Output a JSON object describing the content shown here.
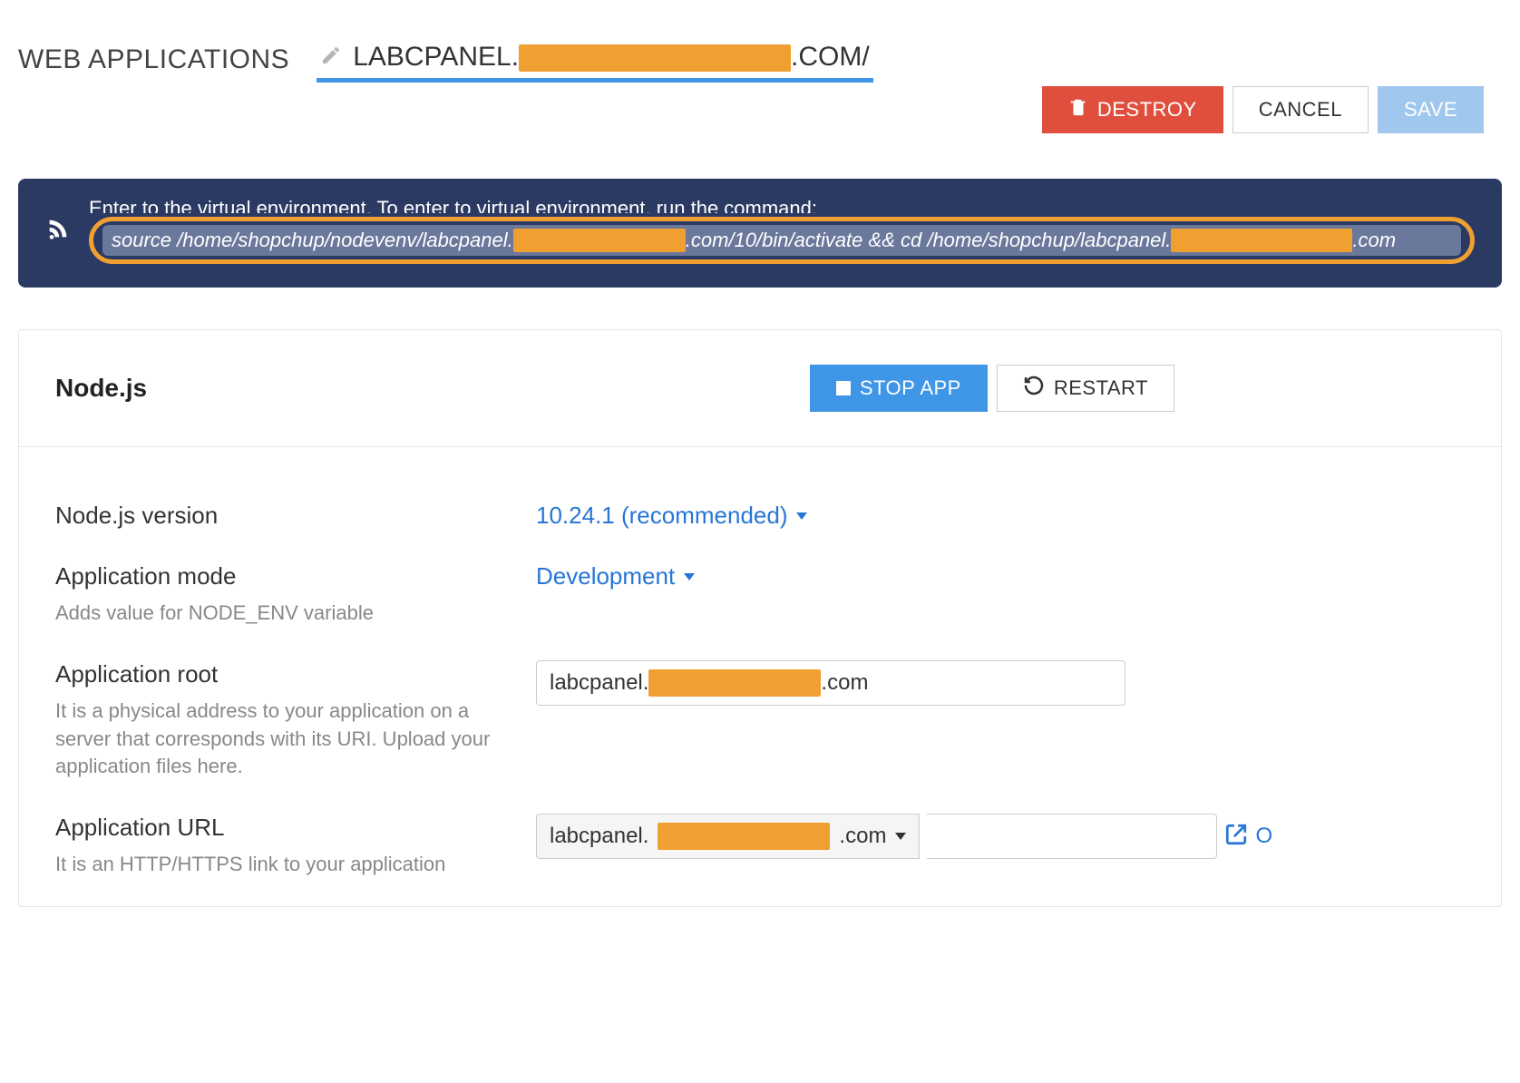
{
  "header": {
    "page_title": "WEB APPLICATIONS",
    "app_name_prefix": "LABCPANEL.",
    "app_name_suffix": ".COM/"
  },
  "actions": {
    "destroy": "DESTROY",
    "cancel": "CANCEL",
    "save": "SAVE"
  },
  "banner": {
    "heading": "Enter to the virtual environment. To enter to virtual environment, run the command:",
    "cmd_part1": "source /home/shopchup/nodevenv/labcpanel.",
    "cmd_part2": ".com/10/bin/activate && cd /home/shopchup/labcpanel.",
    "cmd_part3": ".com"
  },
  "card": {
    "title": "Node.js",
    "stop_label": "STOP APP",
    "restart_label": "RESTART"
  },
  "form": {
    "version": {
      "label": "Node.js version",
      "value": "10.24.1 (recommended)"
    },
    "mode": {
      "label": "Application mode",
      "value": "Development",
      "help": "Adds value for NODE_ENV variable"
    },
    "root": {
      "label": "Application root",
      "value_prefix": "labcpanel.",
      "value_suffix": ".com",
      "help": "It is a physical address to your application on a server that corresponds with its URI. Upload your application files here."
    },
    "url": {
      "label": "Application URL",
      "domain_prefix": "labcpanel.",
      "domain_suffix": ".com",
      "help": "It is an HTTP/HTTPS link to your application",
      "open_char": "O"
    }
  }
}
